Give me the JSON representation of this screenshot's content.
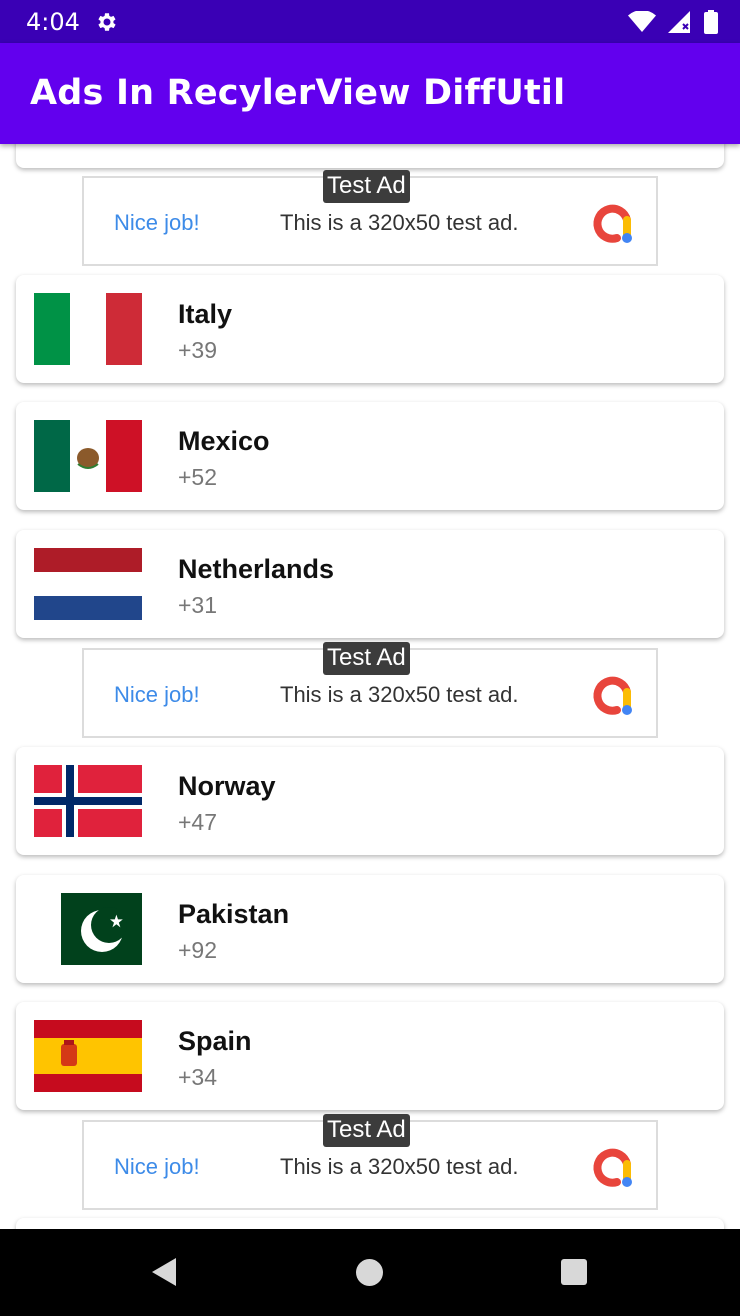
{
  "status_bar": {
    "time": "4:04"
  },
  "app_bar": {
    "title": "Ads In RecylerView DiffUtil"
  },
  "countries": [
    {
      "name": "Italy",
      "code": "+39",
      "flag_icon": "italy-flag-icon"
    },
    {
      "name": "Mexico",
      "code": "+52",
      "flag_icon": "mexico-flag-icon"
    },
    {
      "name": "Netherlands",
      "code": "+31",
      "flag_icon": "netherlands-flag-icon"
    },
    {
      "name": "Norway",
      "code": "+47",
      "flag_icon": "norway-flag-icon"
    },
    {
      "name": "Pakistan",
      "code": "+92",
      "flag_icon": "pakistan-flag-icon"
    },
    {
      "name": "Spain",
      "code": "+34",
      "flag_icon": "spain-flag-icon"
    }
  ],
  "ad": {
    "badge": "Test Ad",
    "headline": "Nice job!",
    "body": "This is a 320x50 test ad."
  },
  "colors": {
    "status_bar": "#3a00b5",
    "app_bar": "#6200ee",
    "ad_headline": "#3d8be8"
  }
}
